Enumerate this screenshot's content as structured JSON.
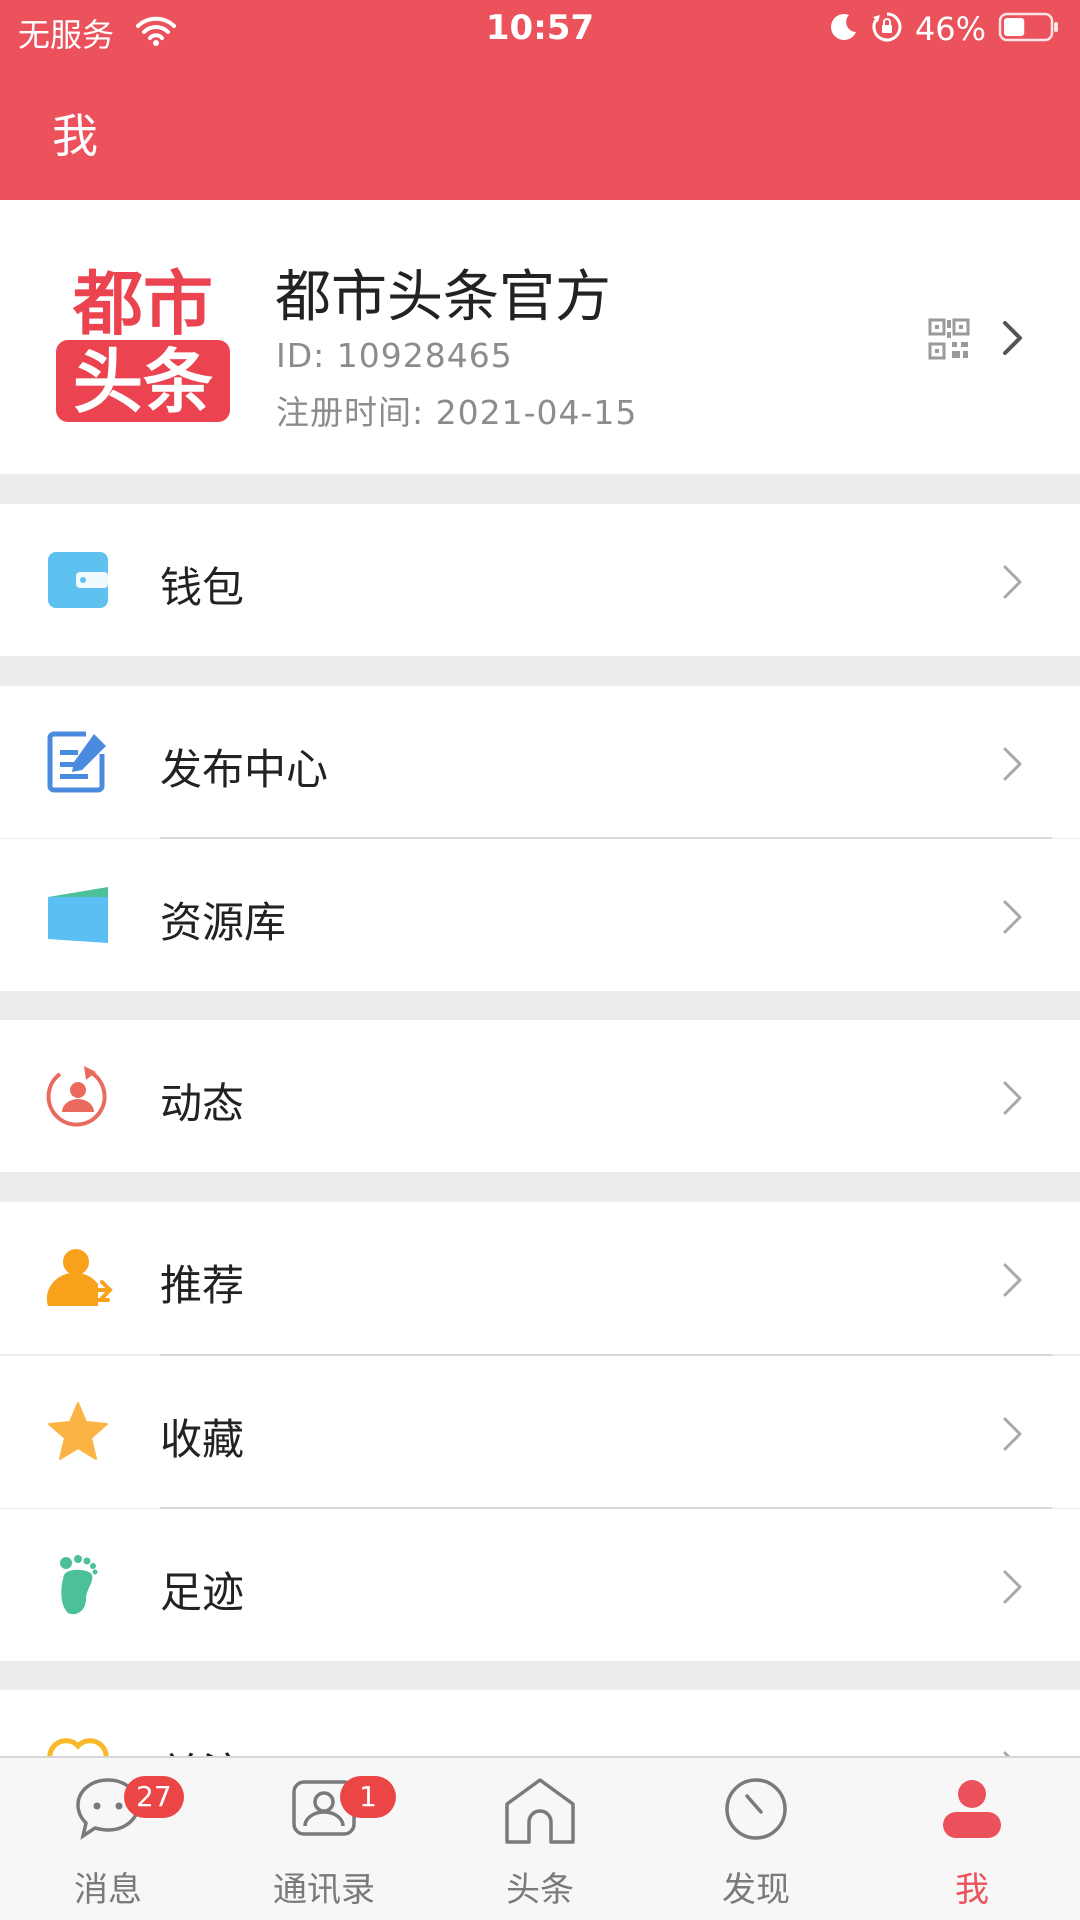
{
  "status_bar": {
    "carrier": "无服务",
    "time": "10:57",
    "battery_percent": "46%",
    "battery_level": 0.46
  },
  "header": {
    "title": "我"
  },
  "profile": {
    "logo_text_line1": "都市",
    "logo_text_line2": "头条",
    "name": "都市头条官方",
    "id_text": "ID: 10928465",
    "registered_text": "注册时间: 2021-04-15"
  },
  "menu": {
    "wallet": "钱包",
    "publish_center": "发布中心",
    "resource_library": "资源库",
    "moments": "动态",
    "recommend": "推荐",
    "favorites": "收藏",
    "footprints": "足迹",
    "follow": "关注"
  },
  "tabbar": {
    "messages": {
      "label": "消息",
      "badge": "27"
    },
    "contacts": {
      "label": "通讯录",
      "badge": "1"
    },
    "headlines": {
      "label": "头条"
    },
    "discover": {
      "label": "发现"
    },
    "me": {
      "label": "我"
    }
  },
  "colors": {
    "brand": "#eb525c",
    "badge": "#eb4545",
    "wallet_icon": "#5ec1ef",
    "publish_icon": "#4a8be0",
    "moments_icon": "#ea6b5e",
    "recommend_icon": "#f8a21c",
    "favorites_icon": "#fbb443",
    "footprints_icon": "#4cc09a"
  }
}
